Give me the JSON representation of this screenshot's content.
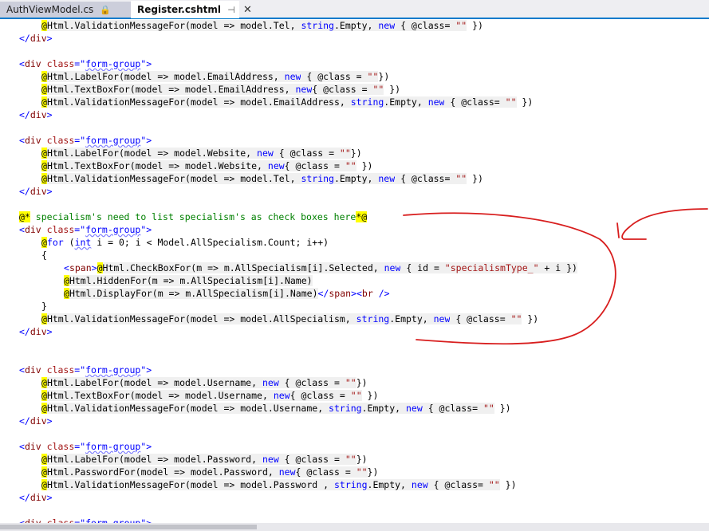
{
  "tabs": [
    {
      "label": "AuthViewModel.cs",
      "active": false,
      "icon": "lock-icon"
    },
    {
      "label": "Register.cshtml",
      "active": true,
      "icon": "pin-icon"
    }
  ],
  "close_glyph": "✕",
  "pin_glyph": "⊣",
  "lock_glyph": "🔒",
  "colors": {
    "keyword": "#0000ff",
    "string": "#a31515",
    "comment": "#008000",
    "razor_highlight": "#ffff00",
    "annotation": "#d81e1e"
  },
  "code_lines": [
    {
      "indent": 1,
      "tokens": [
        [
          "@",
          "y"
        ],
        [
          "Html.ValidationMessageFor(model => model.Tel, ",
          "hl"
        ],
        [
          "string",
          "k hl"
        ],
        [
          ".Empty, ",
          "hl"
        ],
        [
          "new",
          "k hl"
        ],
        [
          " { @class= ",
          "hl"
        ],
        [
          "\"\"",
          "str hl"
        ],
        [
          " })",
          ""
        ]
      ]
    },
    {
      "indent": 0,
      "tokens": [
        [
          "</",
          "k"
        ],
        [
          "div",
          "tag"
        ],
        [
          ">",
          "k"
        ]
      ]
    },
    {
      "indent": 0,
      "tokens": []
    },
    {
      "indent": 0,
      "tokens": [
        [
          "<",
          "k"
        ],
        [
          "div",
          "tag"
        ],
        [
          " class",
          "str"
        ],
        [
          "=\"",
          "k"
        ],
        [
          "form-group",
          "k squig"
        ],
        [
          "\">",
          "k"
        ]
      ]
    },
    {
      "indent": 1,
      "tokens": [
        [
          "@",
          "y"
        ],
        [
          "Html.LabelFor(model => model.EmailAddress, ",
          "hl"
        ],
        [
          "new",
          "k hl"
        ],
        [
          " { @class = ",
          "hl"
        ],
        [
          "\"\"",
          "str hl"
        ],
        [
          "})",
          ""
        ]
      ]
    },
    {
      "indent": 1,
      "tokens": [
        [
          "@",
          "y"
        ],
        [
          "Html.TextBoxFor(model => model.EmailAddress, ",
          "hl"
        ],
        [
          "new",
          "k hl"
        ],
        [
          "{ @class = ",
          "hl"
        ],
        [
          "\"\"",
          "str hl"
        ],
        [
          " })",
          ""
        ]
      ]
    },
    {
      "indent": 1,
      "tokens": [
        [
          "@",
          "y"
        ],
        [
          "Html.ValidationMessageFor(model => model.EmailAddress, ",
          "hl"
        ],
        [
          "string",
          "k hl"
        ],
        [
          ".Empty, ",
          "hl"
        ],
        [
          "new",
          "k hl"
        ],
        [
          " { @class= ",
          "hl"
        ],
        [
          "\"\"",
          "str hl"
        ],
        [
          " })",
          ""
        ]
      ]
    },
    {
      "indent": 0,
      "tokens": [
        [
          "</",
          "k"
        ],
        [
          "div",
          "tag"
        ],
        [
          ">",
          "k"
        ]
      ]
    },
    {
      "indent": 0,
      "tokens": []
    },
    {
      "indent": 0,
      "tokens": [
        [
          "<",
          "k"
        ],
        [
          "div",
          "tag"
        ],
        [
          " class",
          "str"
        ],
        [
          "=\"",
          "k"
        ],
        [
          "form-group",
          "k squig"
        ],
        [
          "\">",
          "k"
        ]
      ]
    },
    {
      "indent": 1,
      "tokens": [
        [
          "@",
          "y"
        ],
        [
          "Html.LabelFor(model => model.Website, ",
          "hl"
        ],
        [
          "new",
          "k hl"
        ],
        [
          " { @class = ",
          "hl"
        ],
        [
          "\"\"",
          "str hl"
        ],
        [
          "})",
          ""
        ]
      ]
    },
    {
      "indent": 1,
      "tokens": [
        [
          "@",
          "y"
        ],
        [
          "Html.TextBoxFor(model => model.Website, ",
          "hl"
        ],
        [
          "new",
          "k hl"
        ],
        [
          "{ @class = ",
          "hl"
        ],
        [
          "\"\"",
          "str hl"
        ],
        [
          " })",
          ""
        ]
      ]
    },
    {
      "indent": 1,
      "tokens": [
        [
          "@",
          "y"
        ],
        [
          "Html.ValidationMessageFor(model => model.Tel, ",
          "hl"
        ],
        [
          "string",
          "k hl"
        ],
        [
          ".Empty, ",
          "hl"
        ],
        [
          "new",
          "k hl"
        ],
        [
          " { @class= ",
          "hl"
        ],
        [
          "\"\"",
          "str hl"
        ],
        [
          " })",
          ""
        ]
      ]
    },
    {
      "indent": 0,
      "tokens": [
        [
          "</",
          "k"
        ],
        [
          "div",
          "tag"
        ],
        [
          ">",
          "k"
        ]
      ]
    },
    {
      "indent": 0,
      "tokens": []
    },
    {
      "indent": 0,
      "tokens": [
        [
          "@*",
          "y"
        ],
        [
          " specialism's need to list specialism's as check boxes here",
          "cm"
        ],
        [
          "*@",
          "y"
        ]
      ]
    },
    {
      "indent": 0,
      "tokens": [
        [
          "<",
          "k"
        ],
        [
          "div",
          "tag"
        ],
        [
          " class",
          "str"
        ],
        [
          "=\"",
          "k"
        ],
        [
          "form-group",
          "k squig"
        ],
        [
          "\">",
          "k"
        ]
      ]
    },
    {
      "indent": 1,
      "tokens": [
        [
          "@",
          "y"
        ],
        [
          "for",
          "k"
        ],
        [
          " (",
          "blk"
        ],
        [
          "int",
          "k squig"
        ],
        [
          " i = 0; i < Model.AllSpecialism.Count; i++)",
          "blk"
        ]
      ]
    },
    {
      "indent": 1,
      "tokens": [
        [
          "{",
          "blk"
        ]
      ]
    },
    {
      "indent": 2,
      "tokens": [
        [
          "<",
          "k"
        ],
        [
          "span",
          "tag"
        ],
        [
          ">",
          "k"
        ],
        [
          "@",
          "y"
        ],
        [
          "Html.CheckBoxFor(m => m.AllSpecialism[i].Selected, ",
          "hl"
        ],
        [
          "new",
          "k hl"
        ],
        [
          " { id = ",
          "hl"
        ],
        [
          "\"specialismType_\"",
          "str hl"
        ],
        [
          " + i })",
          "hl"
        ]
      ]
    },
    {
      "indent": 2,
      "tokens": [
        [
          "@",
          "y"
        ],
        [
          "Html.HiddenFor(m => m.AllSpecialism[i].Name)",
          "hl"
        ]
      ]
    },
    {
      "indent": 2,
      "tokens": [
        [
          "@",
          "y"
        ],
        [
          "Html.DisplayFor(m => m.AllSpecialism[i].Name)",
          "hl"
        ],
        [
          "</",
          "k"
        ],
        [
          "span",
          "tag"
        ],
        [
          "><",
          "k"
        ],
        [
          "br",
          "tag"
        ],
        [
          " />",
          "k"
        ]
      ]
    },
    {
      "indent": 1,
      "tokens": [
        [
          "}",
          "blk"
        ]
      ]
    },
    {
      "indent": 1,
      "tokens": [
        [
          "@",
          "y"
        ],
        [
          "Html.ValidationMessageFor(model => model.AllSpecialism, ",
          "hl"
        ],
        [
          "string",
          "k hl"
        ],
        [
          ".Empty, ",
          "hl"
        ],
        [
          "new",
          "k hl"
        ],
        [
          " { @class= ",
          "hl"
        ],
        [
          "\"\"",
          "str hl"
        ],
        [
          " })",
          ""
        ]
      ]
    },
    {
      "indent": 0,
      "tokens": [
        [
          "</",
          "k"
        ],
        [
          "div",
          "tag"
        ],
        [
          ">",
          "k"
        ]
      ]
    },
    {
      "indent": 0,
      "tokens": []
    },
    {
      "indent": 0,
      "tokens": []
    },
    {
      "indent": 0,
      "tokens": [
        [
          "<",
          "k"
        ],
        [
          "div",
          "tag"
        ],
        [
          " class",
          "str"
        ],
        [
          "=\"",
          "k"
        ],
        [
          "form-group",
          "k squig"
        ],
        [
          "\">",
          "k"
        ]
      ]
    },
    {
      "indent": 1,
      "tokens": [
        [
          "@",
          "y"
        ],
        [
          "Html.LabelFor(model => model.Username, ",
          "hl"
        ],
        [
          "new",
          "k hl"
        ],
        [
          " { @class = ",
          "hl"
        ],
        [
          "\"\"",
          "str hl"
        ],
        [
          "})",
          ""
        ]
      ]
    },
    {
      "indent": 1,
      "tokens": [
        [
          "@",
          "y"
        ],
        [
          "Html.TextBoxFor(model => model.Username, ",
          "hl"
        ],
        [
          "new",
          "k hl"
        ],
        [
          "{ @class = ",
          "hl"
        ],
        [
          "\"\"",
          "str hl"
        ],
        [
          " })",
          ""
        ]
      ]
    },
    {
      "indent": 1,
      "tokens": [
        [
          "@",
          "y"
        ],
        [
          "Html.ValidationMessageFor(model => model.Username, ",
          "hl"
        ],
        [
          "string",
          "k hl"
        ],
        [
          ".Empty, ",
          "hl"
        ],
        [
          "new",
          "k hl"
        ],
        [
          " { @class= ",
          "hl"
        ],
        [
          "\"\"",
          "str hl"
        ],
        [
          " })",
          ""
        ]
      ]
    },
    {
      "indent": 0,
      "tokens": [
        [
          "</",
          "k"
        ],
        [
          "div",
          "tag"
        ],
        [
          ">",
          "k"
        ]
      ]
    },
    {
      "indent": 0,
      "tokens": []
    },
    {
      "indent": 0,
      "tokens": [
        [
          "<",
          "k"
        ],
        [
          "div",
          "tag"
        ],
        [
          " class",
          "str"
        ],
        [
          "=\"",
          "k"
        ],
        [
          "form-group",
          "k squig"
        ],
        [
          "\">",
          "k"
        ]
      ]
    },
    {
      "indent": 1,
      "tokens": [
        [
          "@",
          "y"
        ],
        [
          "Html.LabelFor(model => model.Password, ",
          "hl"
        ],
        [
          "new",
          "k hl"
        ],
        [
          " { @class = ",
          "hl"
        ],
        [
          "\"\"",
          "str hl"
        ],
        [
          "})",
          ""
        ]
      ]
    },
    {
      "indent": 1,
      "tokens": [
        [
          "@",
          "y"
        ],
        [
          "Html.PasswordFor(model => model.Password, ",
          "hl"
        ],
        [
          "new",
          "k hl"
        ],
        [
          "{ @class = ",
          "hl"
        ],
        [
          "\"\"",
          "str hl"
        ],
        [
          "})",
          ""
        ]
      ]
    },
    {
      "indent": 1,
      "tokens": [
        [
          "@",
          "y"
        ],
        [
          "Html.ValidationMessageFor(model => model.Password , ",
          "hl"
        ],
        [
          "string",
          "k hl"
        ],
        [
          ".Empty, ",
          "hl"
        ],
        [
          "new",
          "k hl"
        ],
        [
          " { @class= ",
          "hl"
        ],
        [
          "\"\"",
          "str hl"
        ],
        [
          " })",
          ""
        ]
      ]
    },
    {
      "indent": 0,
      "tokens": [
        [
          "</",
          "k"
        ],
        [
          "div",
          "tag"
        ],
        [
          ">",
          "k"
        ]
      ]
    },
    {
      "indent": 0,
      "tokens": []
    },
    {
      "indent": 0,
      "tokens": [
        [
          "<",
          "k"
        ],
        [
          "div",
          "tag"
        ],
        [
          " class",
          "str"
        ],
        [
          "=\"",
          "k"
        ],
        [
          "form-group",
          "k"
        ],
        [
          "\">",
          "k"
        ]
      ]
    }
  ]
}
